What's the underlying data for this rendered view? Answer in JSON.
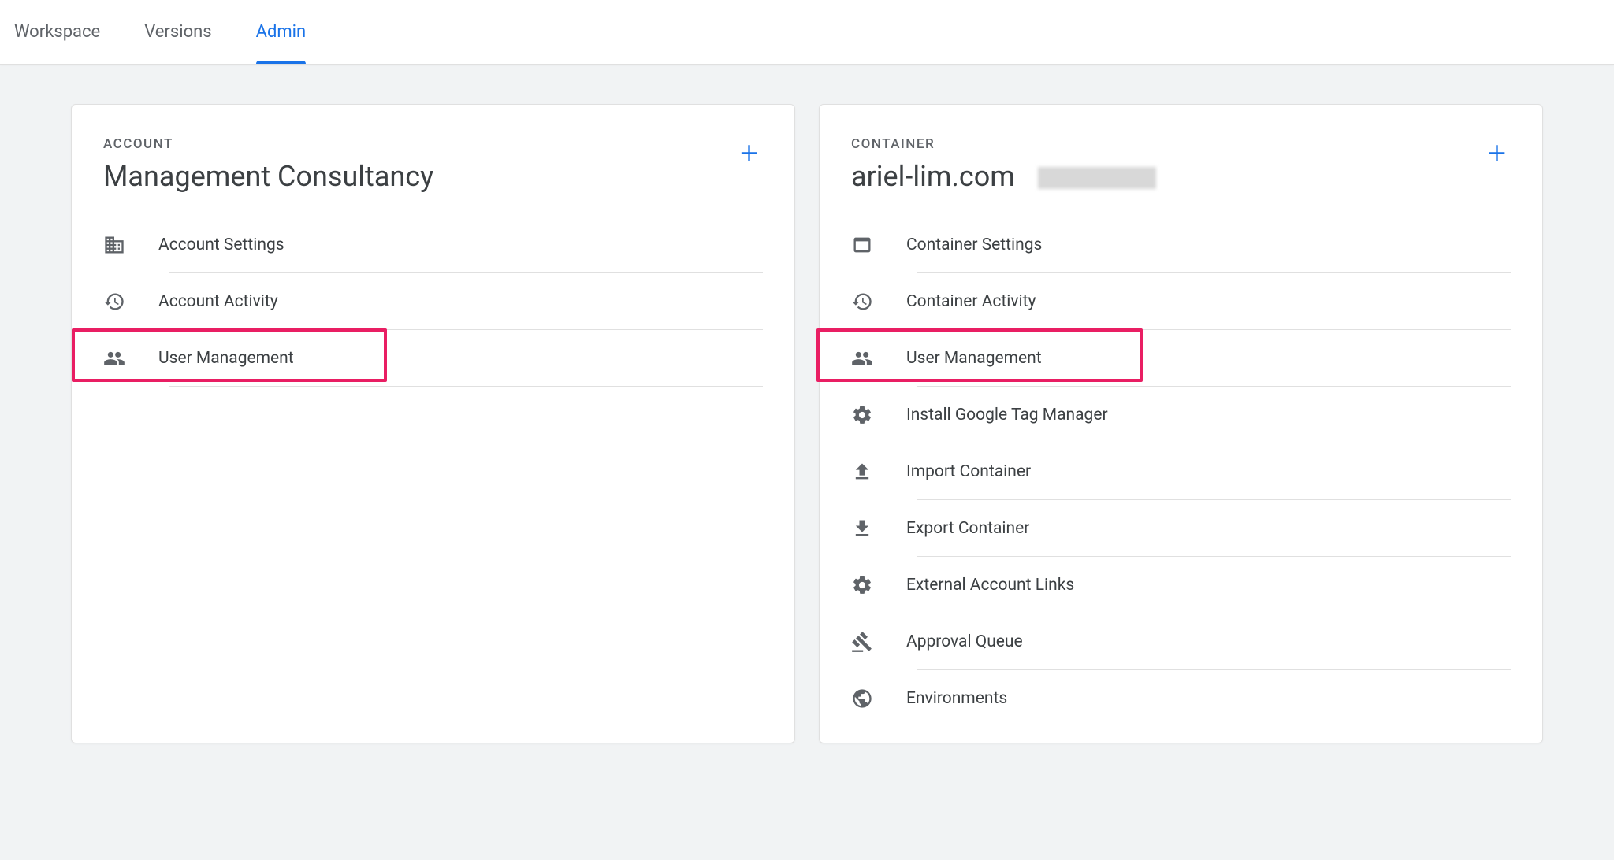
{
  "tabs": {
    "workspace": "Workspace",
    "versions": "Versions",
    "admin": "Admin"
  },
  "account": {
    "label": "ACCOUNT",
    "name": "Management Consultancy",
    "items": [
      {
        "label": "Account Settings"
      },
      {
        "label": "Account Activity"
      },
      {
        "label": "User Management"
      }
    ]
  },
  "container": {
    "label": "CONTAINER",
    "name": "ariel-lim.com",
    "items": [
      {
        "label": "Container Settings"
      },
      {
        "label": "Container Activity"
      },
      {
        "label": "User Management"
      },
      {
        "label": "Install Google Tag Manager"
      },
      {
        "label": "Import Container"
      },
      {
        "label": "Export Container"
      },
      {
        "label": "External Account Links"
      },
      {
        "label": "Approval Queue"
      },
      {
        "label": "Environments"
      }
    ]
  }
}
